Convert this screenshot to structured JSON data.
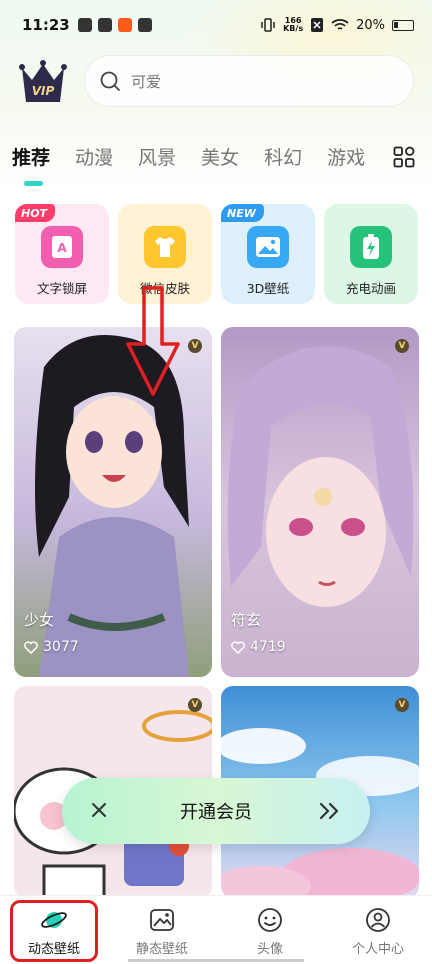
{
  "status_bar": {
    "time": "11:23",
    "net_speed_value": "166",
    "net_speed_unit": "KB/s",
    "battery": "20%"
  },
  "header": {
    "vip_label": "VIP",
    "search_placeholder": "可爱"
  },
  "tabs": [
    "推荐",
    "动漫",
    "风景",
    "美女",
    "科幻",
    "游戏"
  ],
  "quick_entries": [
    {
      "label": "文字锁屏",
      "badge": "HOT",
      "icon": "text-lock-icon"
    },
    {
      "label": "微信皮肤",
      "badge": "",
      "icon": "tshirt-icon"
    },
    {
      "label": "3D壁纸",
      "badge": "NEW",
      "icon": "image-3d-icon"
    },
    {
      "label": "充电动画",
      "badge": "",
      "icon": "battery-charge-icon"
    }
  ],
  "wallpapers": [
    {
      "title": "少女",
      "likes": "3077"
    },
    {
      "title": "符玄",
      "likes": "4719"
    }
  ],
  "member_banner": {
    "label": "开通会员"
  },
  "bottom_nav": [
    {
      "label": "动态壁纸",
      "icon": "planet-icon",
      "active": true
    },
    {
      "label": "静态壁纸",
      "icon": "picture-icon",
      "active": false
    },
    {
      "label": "头像",
      "icon": "smiley-icon",
      "active": false
    },
    {
      "label": "个人中心",
      "icon": "user-icon",
      "active": false
    }
  ],
  "colors": {
    "accent": "#2ed6c8",
    "highlight_red": "#e02020"
  }
}
